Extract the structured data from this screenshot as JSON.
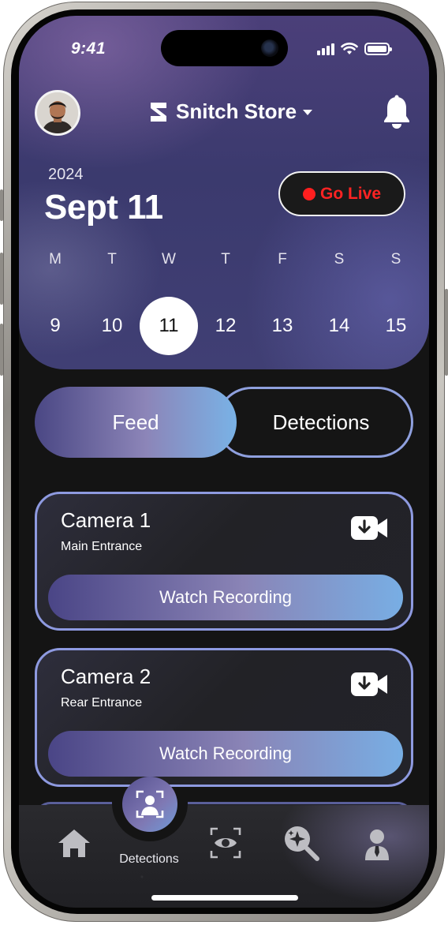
{
  "status_bar": {
    "time": "9:41"
  },
  "header": {
    "store_name": "Snitch Store",
    "year": "2024",
    "date_title": "Sept 11",
    "go_live_label": "Go Live"
  },
  "calendar": {
    "days": [
      {
        "letter": "M",
        "number": "9",
        "selected": false
      },
      {
        "letter": "T",
        "number": "10",
        "selected": false
      },
      {
        "letter": "W",
        "number": "11",
        "selected": true
      },
      {
        "letter": "T",
        "number": "12",
        "selected": false
      },
      {
        "letter": "F",
        "number": "13",
        "selected": false
      },
      {
        "letter": "S",
        "number": "14",
        "selected": false
      },
      {
        "letter": "S",
        "number": "15",
        "selected": false
      }
    ]
  },
  "tabs": {
    "feed": "Feed",
    "detections": "Detections",
    "active": "Feed"
  },
  "cameras": [
    {
      "title": "Camera 1",
      "subtitle": "Main Entrance",
      "button": "Watch Recording"
    },
    {
      "title": "Camera 2",
      "subtitle": "Rear Entrance",
      "button": "Watch Recording"
    }
  ],
  "bottom_nav": {
    "active_label": "Detections",
    "items": [
      "home-icon",
      "face-scan-icon",
      "eye-icon",
      "sparkle-search-icon",
      "person-icon"
    ]
  },
  "colors": {
    "accent_start": "#4a4784",
    "accent_end": "#79b2e6",
    "live_red": "#ff1f1f",
    "background": "#141414"
  }
}
